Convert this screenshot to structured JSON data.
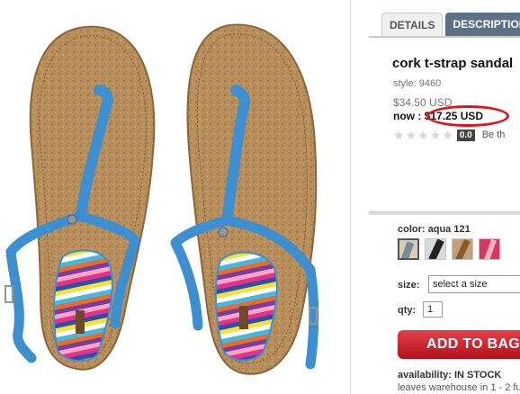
{
  "tabs": [
    {
      "label": "DETAILS"
    },
    {
      "label": "DESCRIPTION"
    }
  ],
  "product": {
    "title": "cork t-strap sandal",
    "style": "style: 9460",
    "original_price": "$34.50 USD",
    "now_label": "now : ",
    "now_price": "$17.25 USD",
    "rating_value": "0.0",
    "rating_stars": 0,
    "rating_cta": "Be th"
  },
  "options": {
    "color_label": "color: aqua 121",
    "swatches": [
      {
        "name": "aqua",
        "color": "#3a8ec8",
        "selected": true
      },
      {
        "name": "black",
        "color": "#222222",
        "selected": false
      },
      {
        "name": "brown",
        "color": "#8a5a2e",
        "selected": false
      },
      {
        "name": "pink",
        "color": "#d8365e",
        "selected": false
      }
    ],
    "size_label": "size:",
    "size_value": "select a size",
    "qty_label": "qty:",
    "qty_value": "1"
  },
  "cta": {
    "add_to_bag": "ADD TO BAG"
  },
  "availability": {
    "label": "availability: IN STOCK",
    "shipping": "leaves warehouse in 1 - 2 fu"
  },
  "colors": {
    "accent_red": "#e3131b",
    "tab_active": "#5d7186",
    "cork": "#b78e5a",
    "strap_blue": "#3d8fcf"
  }
}
